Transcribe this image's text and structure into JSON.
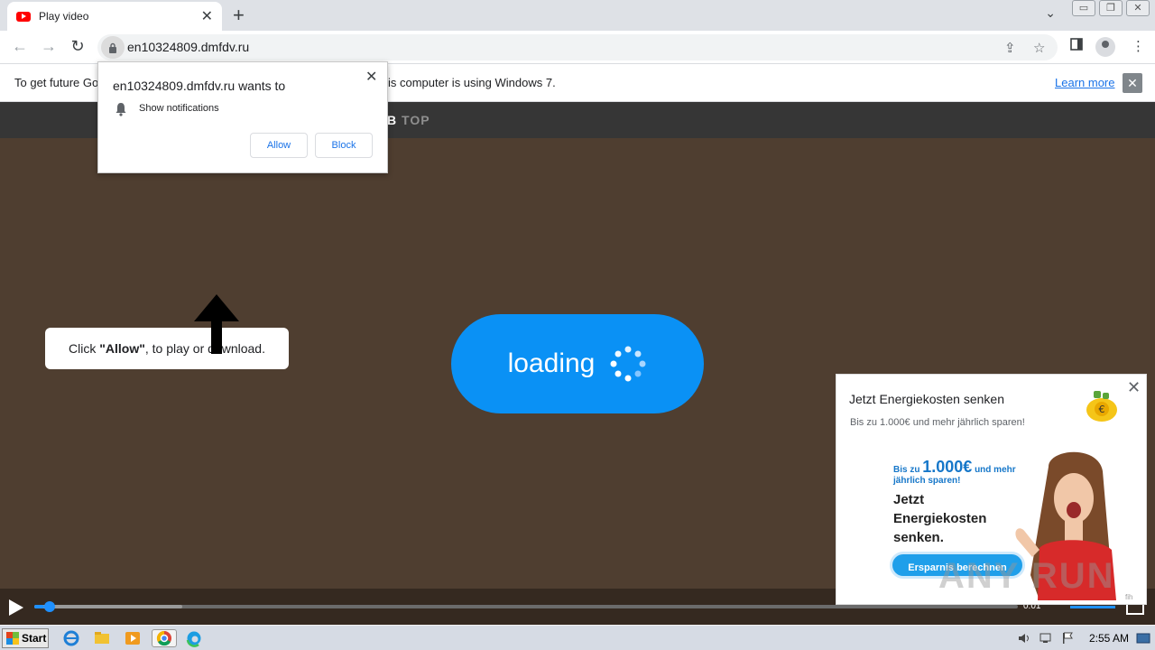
{
  "browser": {
    "tab_title": "Play video",
    "tab_close": "✕",
    "new_tab": "+",
    "url": "en10324809.dmfdv.ru",
    "tab_search": "⌄",
    "window_buttons": [
      "▭",
      "❐",
      "✕"
    ]
  },
  "infobar": {
    "text_left": "To get future Go",
    "text_right": "is computer is using Windows 7.",
    "learn_more": "Learn more",
    "close": "✕"
  },
  "site": {
    "logo_b": "B",
    "logo_top": "TOP"
  },
  "permission_popup": {
    "host_text": "en10324809.dmfdv.ru wants to",
    "permission": "Show notifications",
    "allow": "Allow",
    "block": "Block",
    "close": "✕"
  },
  "hint": {
    "prefix": "Click ",
    "bold": "\"Allow\"",
    "suffix": ", to play or download."
  },
  "loading": {
    "label": "loading"
  },
  "player": {
    "time": "0:01",
    "progress_fraction": 0.01,
    "buffered_fraction": 0.15
  },
  "ad": {
    "heading": "Jetzt Energiekosten senken",
    "subheading": "Bis zu 1.000€ und mehr jährlich sparen!",
    "creative_prefix": "Bis zu ",
    "creative_amount": "1.000€",
    "creative_suffix": " und mehr",
    "creative_line2": "jährlich sparen!",
    "creative_headline_1": "Jetzt",
    "creative_headline_2": "Energiekosten",
    "creative_headline_3": "senken.",
    "cta": "Ersparnis berechnen",
    "tag": "fih",
    "close": "✕"
  },
  "watermark": "ANY RUN",
  "taskbar": {
    "start": "Start",
    "clock": "2:55 AM"
  },
  "colors": {
    "page_bg": "#4f3e30",
    "loading_pill": "#0a91f5",
    "accent_link": "#1a73e8",
    "player_progress": "#1e90ff"
  }
}
